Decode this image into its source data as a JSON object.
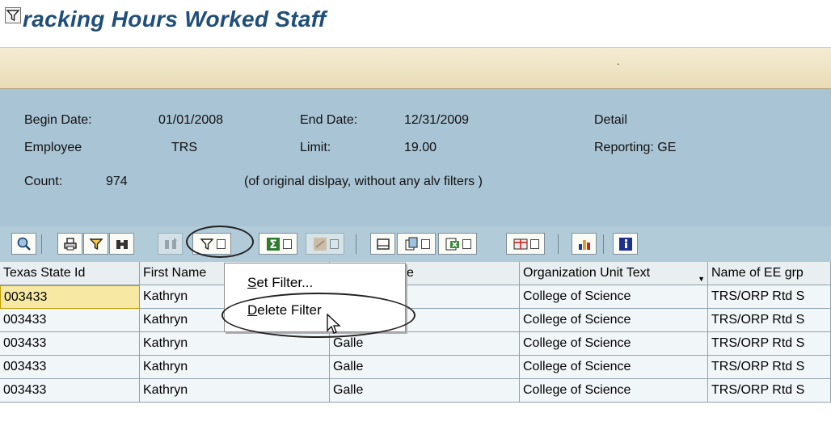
{
  "window": {
    "title": "Tracking Hours Worked Staff",
    "title_visible": "racking Hours Worked Staff",
    "title_icon": "filter-icon"
  },
  "app_toolbar": {
    "marker": "."
  },
  "header": {
    "begin_date_label": "Begin Date:",
    "begin_date_value": "01/01/2008",
    "end_date_label": "End Date:",
    "end_date_value": "12/31/2009",
    "detail_label": "Detail",
    "employee_label": "Employee",
    "employee_value": "TRS",
    "limit_label": "Limit:",
    "limit_value": "19.00",
    "reporting_label": "Reporting: GE",
    "count_label": "Count:",
    "count_value": "974",
    "count_note": "(of original dislpay, without any alv filters )"
  },
  "alv_toolbar": {
    "buttons": [
      "details-icon",
      "print-icon",
      "filter-icon",
      "find-icon",
      "find-next-icon",
      "set-filter-icon",
      "sum-icon",
      "subtotal-icon",
      "print-preview-icon",
      "export-icon",
      "spreadsheet-icon",
      "layout-icon",
      "graphic-icon",
      "info-icon"
    ]
  },
  "grid": {
    "columns": [
      "Texas State Id",
      "First Name",
      "e",
      "Organization Unit Text",
      "Name of EE grp"
    ],
    "rows": [
      [
        "003433",
        "Kathryn",
        "",
        "College of Science",
        "TRS/ORP Rtd S"
      ],
      [
        "003433",
        "Kathryn",
        "Galle",
        "College of Science",
        "TRS/ORP Rtd S"
      ],
      [
        "003433",
        "Kathryn",
        "Galle",
        "College of Science",
        "TRS/ORP Rtd S"
      ],
      [
        "003433",
        "Kathryn",
        "Galle",
        "College of Science",
        "TRS/ORP Rtd S"
      ],
      [
        "003433",
        "Kathryn",
        "Galle",
        "College of Science",
        "TRS/ORP Rtd S"
      ]
    ]
  },
  "context_menu": {
    "items": [
      {
        "label": "Set Filter..."
      },
      {
        "label": "Delete Filter",
        "highlighted": true
      }
    ]
  },
  "colors": {
    "title": "#1f4e7a",
    "header_panel": "#a9c4d4",
    "alv_toolbar": "#b2cbd9",
    "selected_cell": "#f7e9a3",
    "app_toolbar": "#efe4c6"
  }
}
